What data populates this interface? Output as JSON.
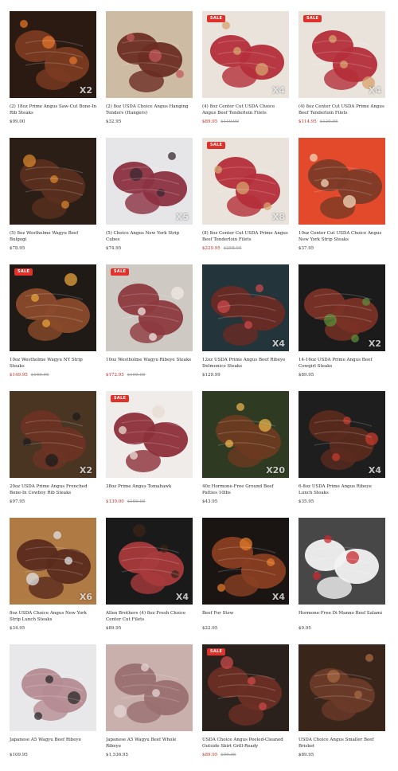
{
  "products": [
    {
      "title": "(2) 18oz Prime Angus Saw-Cut Bone-In Rib Steaks",
      "price": "$99.00",
      "old_price": "",
      "badge": "",
      "qty": "X2",
      "palette": {
        "bg": "#2b1a12",
        "meat": "#7a3b22",
        "accent": "#e2742a"
      }
    },
    {
      "title": "(2) 8oz USDA Choice Angus Hanging Tenders (Hangers)",
      "price": "$32.95",
      "old_price": "",
      "badge": "",
      "qty": "",
      "palette": {
        "bg": "#cdbba3",
        "meat": "#6b2d23",
        "accent": "#c2585a"
      }
    },
    {
      "title": "(4) 8oz Center Cut USDA Choice Angus Beef Tenderloin Filets",
      "price": "$89.95",
      "old_price": "$119.99",
      "badge": "SALE",
      "qty": "X4",
      "palette": {
        "bg": "#e9e3db",
        "meat": "#b42e3a",
        "accent": "#d7a36e"
      }
    },
    {
      "title": "(4) 8oz Center Cut USDA Prime Angus Beef Tenderloin Filets",
      "price": "$114.95",
      "old_price": "$129.95",
      "badge": "SALE",
      "qty": "X4",
      "palette": {
        "bg": "#e9e3db",
        "meat": "#b42e3a",
        "accent": "#d7a36e"
      }
    },
    {
      "title": "(5) 8oz Westholme Wagyu Beef Bulgogi",
      "price": "$78.95",
      "old_price": "",
      "badge": "",
      "qty": "",
      "palette": {
        "bg": "#2a1e16",
        "meat": "#5a2f1e",
        "accent": "#d7842c"
      }
    },
    {
      "title": "(5) Choice Angus New York Strip Cubes",
      "price": "$74.95",
      "old_price": "",
      "badge": "",
      "qty": "X5",
      "palette": {
        "bg": "#e6e6e8",
        "meat": "#8c3141",
        "accent": "#3a2a33"
      }
    },
    {
      "title": "(8) 8oz Center Cut USDA Prime Angus Beef Tenderloin Filets",
      "price": "$229.95",
      "old_price": "$258.95",
      "badge": "SALE",
      "qty": "X8",
      "palette": {
        "bg": "#e9e3db",
        "meat": "#b42e3a",
        "accent": "#d7a36e"
      }
    },
    {
      "title": "10oz Center Cut USDA Choice Angus New York Strip Steaks",
      "price": "$37.95",
      "old_price": "",
      "badge": "",
      "qty": "",
      "palette": {
        "bg": "#e34a2c",
        "meat": "#7b3a26",
        "accent": "#f1d7b8"
      }
    },
    {
      "title": "10oz Westholme Wagyu NY Strip Steaks",
      "price": "$149.95",
      "old_price": "$169.95",
      "badge": "SALE",
      "qty": "",
      "palette": {
        "bg": "#1f1a16",
        "meat": "#8a4a2a",
        "accent": "#e6a13b"
      }
    },
    {
      "title": "10oz Westholme Wagyu Ribeye Steaks",
      "price": "$172.95",
      "old_price": "$199.95",
      "badge": "SALE",
      "qty": "",
      "palette": {
        "bg": "#cfc9c3",
        "meat": "#8c3a3e",
        "accent": "#f0e7e2"
      }
    },
    {
      "title": "12oz USDA Prime Angus Beef Ribeye Delmonico Steaks",
      "price": "$129.99",
      "old_price": "",
      "badge": "",
      "qty": "X4",
      "palette": {
        "bg": "#23343a",
        "meat": "#6a2b24",
        "accent": "#c94a4a"
      }
    },
    {
      "title": "14-16oz USDA Prime Angus Beef Cowgirl Steaks",
      "price": "$89.95",
      "old_price": "",
      "badge": "",
      "qty": "X2",
      "palette": {
        "bg": "#1b1b1b",
        "meat": "#7a3226",
        "accent": "#5e8c3a"
      }
    },
    {
      "title": "20oz USDA Prime Angus Frenched Bone-In Cowboy Rib Steaks",
      "price": "$97.95",
      "old_price": "",
      "badge": "",
      "qty": "X2",
      "palette": {
        "bg": "#4a3422",
        "meat": "#6a3324",
        "accent": "#1c1c1c"
      }
    },
    {
      "title": "38oz Prime Angus Tomahawk",
      "price": "$139.00",
      "old_price": "$169.95",
      "badge": "SALE",
      "qty": "",
      "palette": {
        "bg": "#efece9",
        "meat": "#8c2f3a",
        "accent": "#e9dcd3"
      }
    },
    {
      "title": "40z Hormone-Free Ground Beef Patties 10lbs",
      "price": "$43.95",
      "old_price": "",
      "badge": "",
      "qty": "X20",
      "palette": {
        "bg": "#2e3b22",
        "meat": "#6b3a20",
        "accent": "#e6b14b"
      }
    },
    {
      "title": "6-8oz USDA Prime Angus Ribeye Lunch Steaks",
      "price": "$35.95",
      "old_price": "",
      "badge": "",
      "qty": "X4",
      "palette": {
        "bg": "#1e1e1e",
        "meat": "#5a2a1e",
        "accent": "#c43b2c"
      }
    },
    {
      "title": "8oz USDA Choice Angus New York Strip Lunch Steaks",
      "price": "$34.95",
      "old_price": "",
      "badge": "",
      "qty": "X6",
      "palette": {
        "bg": "#b07a44",
        "meat": "#5a2a1e",
        "accent": "#dfe3e6"
      }
    },
    {
      "title": "Allen Brothers (4) 8oz Fresh Choice Center Cut Filets",
      "price": "$89.95",
      "old_price": "",
      "badge": "",
      "qty": "X4",
      "palette": {
        "bg": "#1a1a1a",
        "meat": "#a83a3c",
        "accent": "#3c2418"
      }
    },
    {
      "title": "Beef For Stew",
      "price": "$22.95",
      "old_price": "",
      "badge": "",
      "qty": "X4",
      "palette": {
        "bg": "#1a1512",
        "meat": "#8a3e22",
        "accent": "#e47a2a"
      }
    },
    {
      "title": "Hormone-Free Di Manno Beef Salami",
      "price": "$9.95",
      "old_price": "",
      "badge": "",
      "qty": "",
      "palette": {
        "bg": "#474747",
        "meat": "#f2f2f2",
        "accent": "#c8292f"
      }
    },
    {
      "title": "Japanese A5 Wagyu Beef Ribeye",
      "price": "$109.95",
      "old_price": "",
      "badge": "",
      "qty": "",
      "palette": {
        "bg": "#e8e8ea",
        "meat": "#b58c93",
        "accent": "#2a2a2a"
      }
    },
    {
      "title": "Japanese A5 Wagyu Beef Whole Ribeye",
      "price": "$1,536.95",
      "old_price": "",
      "badge": "",
      "qty": "",
      "palette": {
        "bg": "#c9b0ad",
        "meat": "#9a6f70",
        "accent": "#e6d6d4"
      }
    },
    {
      "title": "USDA Choice Angus Peeled-Cleaned Outside Skirt Grill-Ready",
      "price": "$89.95",
      "old_price": "$99.95",
      "badge": "SALE",
      "qty": "",
      "palette": {
        "bg": "#2a211c",
        "meat": "#6b2f24",
        "accent": "#c94a4a"
      }
    },
    {
      "title": "USDA Choice Angus Smaller Beef Brisket",
      "price": "$89.95",
      "old_price": "",
      "badge": "",
      "qty": "",
      "palette": {
        "bg": "#3a251b",
        "meat": "#6a3a28",
        "accent": "#a46a44"
      }
    }
  ]
}
